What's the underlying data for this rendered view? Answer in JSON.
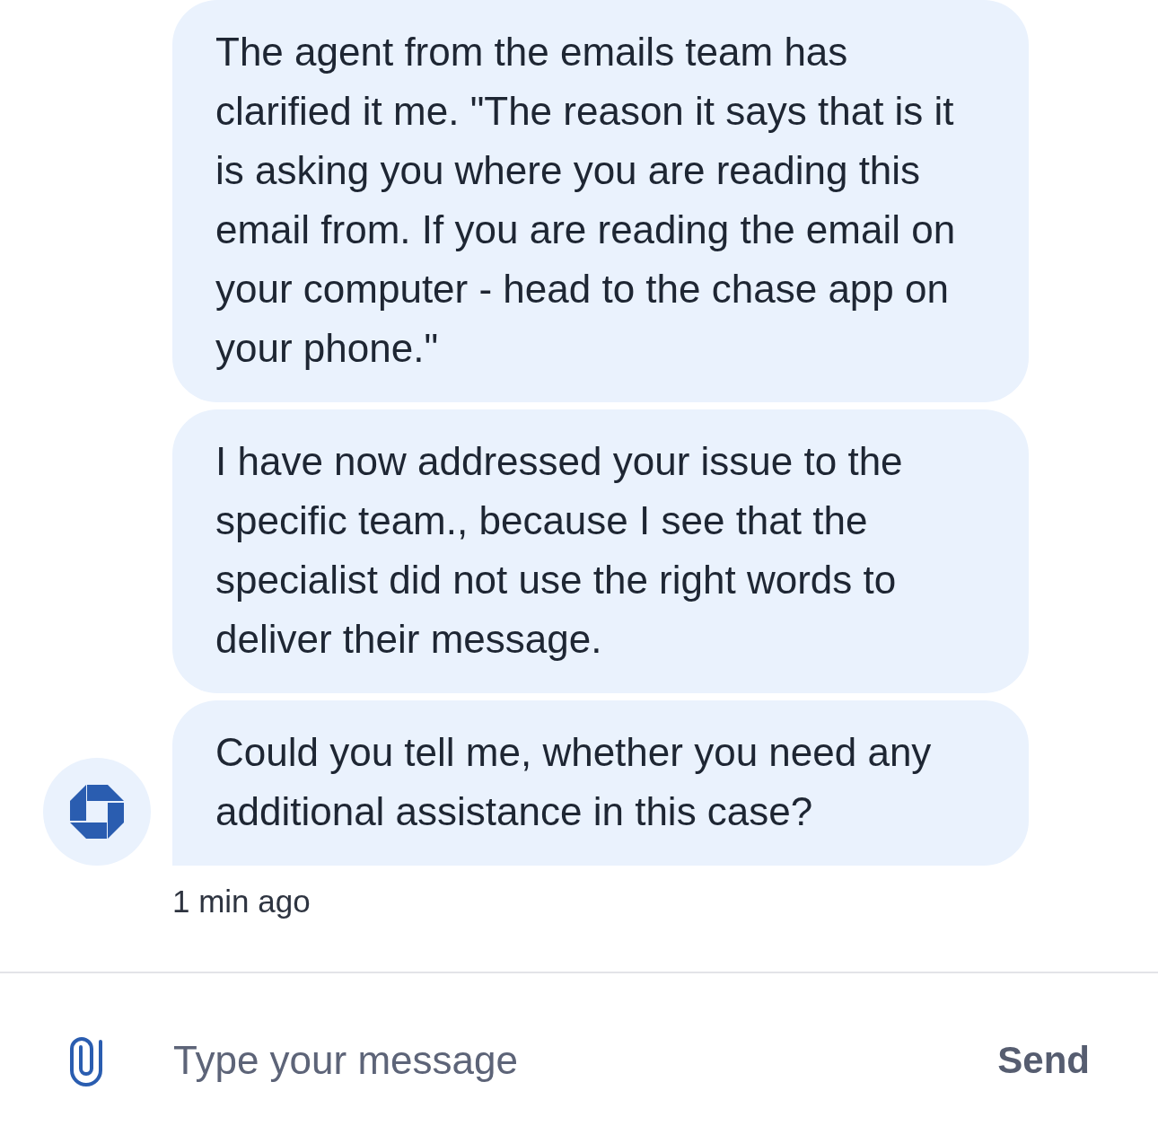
{
  "messages": [
    {
      "text": "The agent from the emails team has clarified it me. \"The reason it says that is it is asking you where you are reading this email from. If you are reading the email on your computer - head to the chase app on your phone.\""
    },
    {
      "text": "I have now addressed your issue to the specific team., because I see that the specialist did not use the right words to deliver their message."
    },
    {
      "text": "Could you tell me, whether you need any additional assistance in this case?"
    }
  ],
  "timestamp": "1 min ago",
  "composer": {
    "placeholder": "Type your message",
    "send_label": "Send"
  }
}
